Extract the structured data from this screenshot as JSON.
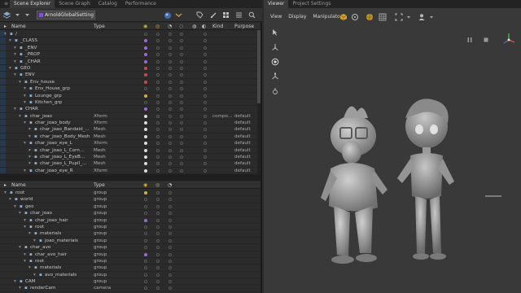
{
  "left_tabs": [
    "Scene Explorer",
    "Scene Graph",
    "Catalog",
    "Performance"
  ],
  "right_tabs": [
    "Viewer",
    "Project Settings"
  ],
  "toolbar": {
    "set_name": "ArnoldGlobalSetting"
  },
  "top_columns": {
    "name": "Name",
    "type": "Type",
    "kind": "Kind",
    "purpose": "Purpose"
  },
  "bottom_columns": {
    "name": "Name",
    "type": "Type"
  },
  "top_rows": [
    {
      "indent": 0,
      "name": "/",
      "type": "",
      "kind": "",
      "purpose": "",
      "vis": "",
      "sel": false
    },
    {
      "indent": 1,
      "name": "_CLASS",
      "type": "",
      "kind": "",
      "purpose": "",
      "vis": "purple",
      "sel": false
    },
    {
      "indent": 2,
      "name": "_ENV",
      "type": "",
      "kind": "",
      "purpose": "",
      "vis": "purple",
      "sel": false
    },
    {
      "indent": 2,
      "name": "_PROP",
      "type": "",
      "kind": "",
      "purpose": "",
      "vis": "purple",
      "sel": false
    },
    {
      "indent": 2,
      "name": "_CHAR",
      "type": "",
      "kind": "",
      "purpose": "",
      "vis": "purple",
      "sel": false
    },
    {
      "indent": 1,
      "name": "GEO",
      "type": "",
      "kind": "",
      "purpose": "",
      "vis": "red",
      "sel": false
    },
    {
      "indent": 2,
      "name": "ENV",
      "type": "",
      "kind": "",
      "purpose": "",
      "vis": "red",
      "sel": false
    },
    {
      "indent": 3,
      "name": "Env_house",
      "type": "",
      "kind": "",
      "purpose": "",
      "vis": "red",
      "sel": false
    },
    {
      "indent": 4,
      "name": "Env_House_grp",
      "type": "",
      "kind": "",
      "purpose": "",
      "vis": "",
      "sel": false
    },
    {
      "indent": 4,
      "name": "Lounge_grp",
      "type": "",
      "kind": "",
      "purpose": "",
      "vis": "yellow",
      "sel": false
    },
    {
      "indent": 4,
      "name": "Kitchen_grp",
      "type": "",
      "kind": "",
      "purpose": "",
      "vis": "",
      "sel": false
    },
    {
      "indent": 2,
      "name": "CHAR",
      "type": "",
      "kind": "",
      "purpose": "",
      "vis": "purple",
      "sel": false
    },
    {
      "indent": 3,
      "name": "char_joao",
      "type": "Xform",
      "kind": "compo...",
      "purpose": "default",
      "vis": "white",
      "sel": false
    },
    {
      "indent": 4,
      "name": "char_joao_body",
      "type": "Xform",
      "kind": "",
      "purpose": "default",
      "vis": "white",
      "sel": false
    },
    {
      "indent": 5,
      "name": "char_joao_Bandaid_...",
      "type": "Mesh",
      "kind": "",
      "purpose": "default",
      "vis": "white",
      "sel": false
    },
    {
      "indent": 5,
      "name": "char_joao_Body_Mesh",
      "type": "Mesh",
      "kind": "",
      "purpose": "default",
      "vis": "white",
      "sel": false
    },
    {
      "indent": 4,
      "name": "char_joao_eye_L",
      "type": "Xform",
      "kind": "",
      "purpose": "default",
      "vis": "white",
      "sel": false
    },
    {
      "indent": 5,
      "name": "char_joao_L_Corn...",
      "type": "Mesh",
      "kind": "",
      "purpose": "default",
      "vis": "white",
      "sel": false
    },
    {
      "indent": 5,
      "name": "char_joao_L_EyeB...",
      "type": "Mesh",
      "kind": "",
      "purpose": "default",
      "vis": "white",
      "sel": false
    },
    {
      "indent": 5,
      "name": "char_joao_L_Pupil_...",
      "type": "Mesh",
      "kind": "",
      "purpose": "default",
      "vis": "white",
      "sel": false
    },
    {
      "indent": 4,
      "name": "char_joao_eye_R",
      "type": "Xform",
      "kind": "",
      "purpose": "default",
      "vis": "white",
      "sel": false
    }
  ],
  "bottom_rows": [
    {
      "indent": 0,
      "name": "root",
      "type": "group",
      "vis": "yellow"
    },
    {
      "indent": 1,
      "name": "world",
      "type": "group",
      "vis": ""
    },
    {
      "indent": 2,
      "name": "geo",
      "type": "group",
      "vis": ""
    },
    {
      "indent": 3,
      "name": "char_joao",
      "type": "group",
      "vis": ""
    },
    {
      "indent": 4,
      "name": "char_joao_hair",
      "type": "group",
      "vis": "purple"
    },
    {
      "indent": 4,
      "name": "root",
      "type": "group",
      "vis": ""
    },
    {
      "indent": 5,
      "name": "materials",
      "type": "group",
      "vis": ""
    },
    {
      "indent": 6,
      "name": "joao_materials",
      "type": "group",
      "vis": ""
    },
    {
      "indent": 3,
      "name": "char_avo",
      "type": "group",
      "vis": ""
    },
    {
      "indent": 4,
      "name": "char_avo_hair",
      "type": "group",
      "vis": "purple"
    },
    {
      "indent": 4,
      "name": "root",
      "type": "group",
      "vis": ""
    },
    {
      "indent": 5,
      "name": "materials",
      "type": "group",
      "vis": ""
    },
    {
      "indent": 6,
      "name": "avo_materials",
      "type": "group",
      "vis": ""
    },
    {
      "indent": 2,
      "name": "CAM",
      "type": "group",
      "vis": ""
    },
    {
      "indent": 3,
      "name": "renderCam",
      "type": "camera",
      "vis": ""
    }
  ],
  "viewer_menu": [
    "View",
    "Display",
    "Manipulators"
  ],
  "colors": {
    "accent": "#7b55c9",
    "selection": "#2f4a63",
    "vis_purple": "#9a6bd8",
    "vis_red": "#c84a4a",
    "vis_yellow": "#d6b13a",
    "vis_white": "#dcdcdc"
  }
}
